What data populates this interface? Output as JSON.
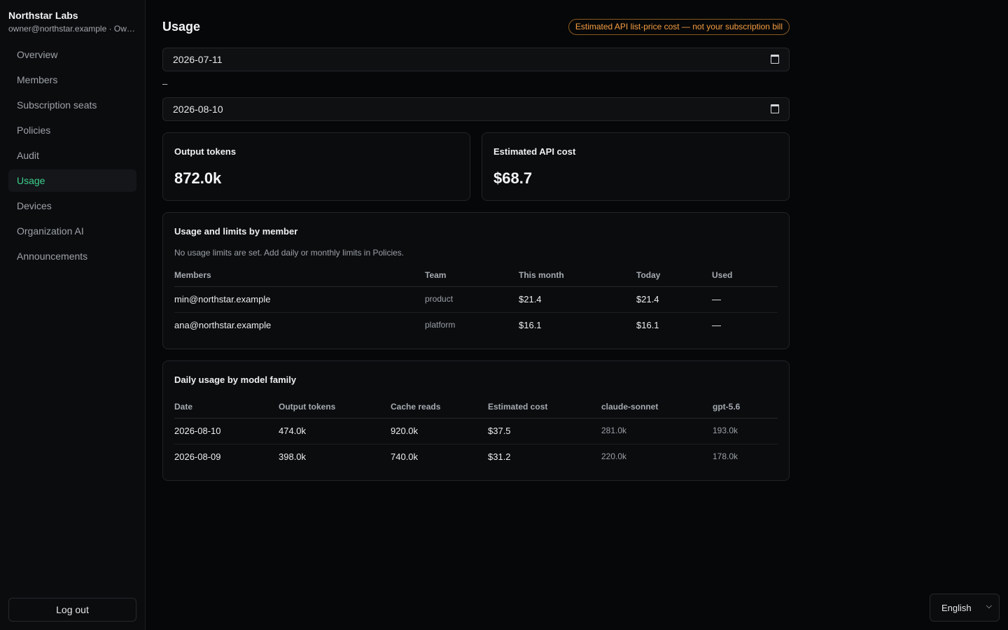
{
  "sidebar": {
    "org_name": "Northstar Labs",
    "org_sub": "owner@northstar.example · Owner",
    "items": [
      {
        "label": "Overview"
      },
      {
        "label": "Members"
      },
      {
        "label": "Subscription seats"
      },
      {
        "label": "Policies"
      },
      {
        "label": "Audit"
      },
      {
        "label": "Usage",
        "active": true
      },
      {
        "label": "Devices"
      },
      {
        "label": "Organization AI"
      },
      {
        "label": "Announcements"
      }
    ],
    "logout_label": "Log out"
  },
  "header": {
    "title": "Usage",
    "badge": "Estimated API list-price cost — not your subscription bill"
  },
  "date_range": {
    "start": "2026-07-11",
    "separator": "–",
    "end": "2026-08-10"
  },
  "stats": {
    "output_tokens": {
      "label": "Output tokens",
      "value": "872.0k"
    },
    "api_cost": {
      "label": "Estimated API cost",
      "value": "$68.7"
    }
  },
  "members_table": {
    "title": "Usage and limits by member",
    "note": "No usage limits are set. Add daily or monthly limits in Policies.",
    "columns": [
      "Members",
      "Team",
      "This month",
      "Today",
      "Used"
    ],
    "rows": [
      [
        "min@northstar.example",
        "product",
        "$21.4",
        "$21.4",
        "—"
      ],
      [
        "ana@northstar.example",
        "platform",
        "$16.1",
        "$16.1",
        "—"
      ]
    ]
  },
  "daily_table": {
    "title": "Daily usage by model family",
    "columns": [
      "Date",
      "Output tokens",
      "Cache reads",
      "Estimated cost",
      "claude-sonnet",
      "gpt-5.6"
    ],
    "rows": [
      [
        "2026-08-10",
        "474.0k",
        "920.0k",
        "$37.5",
        "281.0k",
        "193.0k"
      ],
      [
        "2026-08-09",
        "398.0k",
        "740.0k",
        "$31.2",
        "220.0k",
        "178.0k"
      ]
    ]
  },
  "language": {
    "selected": "English"
  },
  "colors": {
    "accent": "#3ecf8e",
    "warning": "#f59e42",
    "background": "#060708"
  }
}
